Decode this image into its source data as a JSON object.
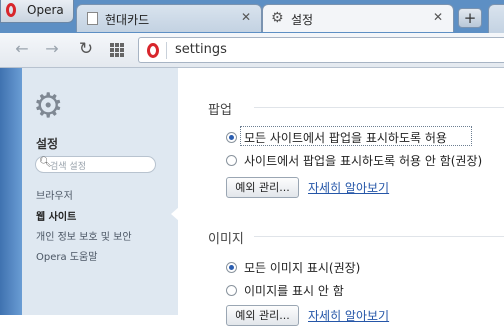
{
  "browser": {
    "menu_label": "Opera",
    "tabs": [
      {
        "label": "현대카드",
        "close": "✕"
      },
      {
        "label": "설정",
        "close": "✕"
      }
    ],
    "new_tab": "+",
    "address": "settings"
  },
  "sidebar": {
    "title": "설정",
    "search_placeholder": "검색 설정",
    "items": [
      {
        "label": "브라우저",
        "active": false
      },
      {
        "label": "웹 사이트",
        "active": true
      },
      {
        "label": "개인 정보 보호 및 보안",
        "active": false
      },
      {
        "label": "Opera 도움말",
        "active": false
      }
    ]
  },
  "content": {
    "popups": {
      "title": "팝업",
      "options": [
        {
          "label": "모든 사이트에서 팝업을 표시하도록 허용",
          "selected": true
        },
        {
          "label": "사이트에서 팝업을 표시하도록 허용 안 함(권장)",
          "selected": false
        }
      ],
      "manage_button": "예외 관리...",
      "learn_more": "자세히 알아보기"
    },
    "images": {
      "title": "이미지",
      "options": [
        {
          "label": "모든 이미지 표시(권장)",
          "selected": true
        },
        {
          "label": "이미지를 표시 안 함",
          "selected": false
        }
      ],
      "manage_button": "예외 관리...",
      "learn_more": "자세히 알아보기"
    }
  },
  "colors": {
    "tabstrip": "#5d8fc4",
    "sidebar": "#dfe8f1",
    "link": "#2556a8",
    "opera_red": "#d8262c"
  }
}
